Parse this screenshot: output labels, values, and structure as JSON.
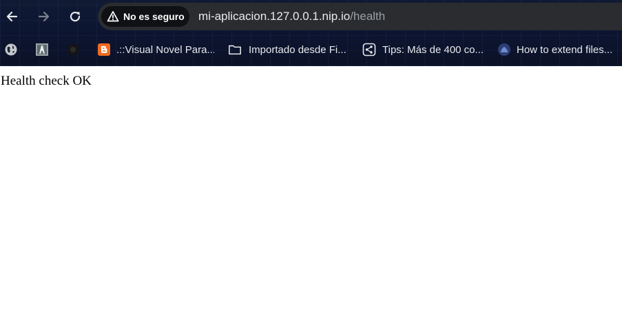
{
  "toolbar": {
    "back_icon": "arrow-left-icon",
    "forward_icon": "arrow-right-icon",
    "reload_icon": "reload-icon"
  },
  "omnibox": {
    "security_label": "No es seguro",
    "url_host": "mi-aplicacion.127.0.0.1.nip.io",
    "url_path": "/health"
  },
  "bookmarks": [
    {
      "icon": "globe-icon",
      "label": ""
    },
    {
      "icon": "bookmark-favicon-icon",
      "label": ""
    },
    {
      "icon": "bookmark-favicon-dark-icon",
      "label": ""
    },
    {
      "icon": "blogger-icon",
      "label": ".::Visual Novel Para..."
    },
    {
      "icon": "folder-icon",
      "label": "Importado desde Fi..."
    },
    {
      "icon": "share-icon",
      "label": "Tips: Más de 400 co..."
    },
    {
      "icon": "drop-icon",
      "label": "How to extend files..."
    }
  ],
  "page": {
    "body_text": "Health check OK"
  },
  "colors": {
    "frame_bg": "#0c1430",
    "omnibox_bg": "#2a2c30",
    "chip_bg": "#101114",
    "url_host": "#e8eaed",
    "url_path": "#9aa0a6",
    "blogger_orange": "#f26b21",
    "page_bg": "#ffffff"
  }
}
